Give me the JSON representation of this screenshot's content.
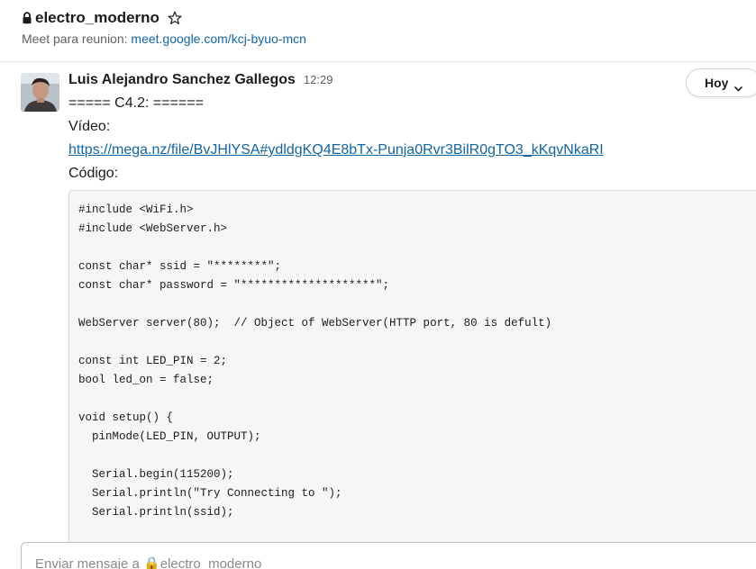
{
  "channel": {
    "name": "electro_moderno",
    "topic_prefix": "Meet para reunion: ",
    "topic_link": "meet.google.com/kcj-byuo-mcn"
  },
  "message": {
    "sender": "Luis Alejandro Sanchez Gallegos",
    "time": "12:29",
    "line1": "===== C4.2: ======",
    "video_label": "Vídeo:",
    "video_link": "https://mega.nz/file/BvJHlYSA#ydldgKQ4E8bTx-Punja0Rvr3BilR0gTO3_kKqvNkaRI",
    "code_label": "Código:",
    "code": "#include <WiFi.h>\n#include <WebServer.h>\n\nconst char* ssid = \"********\";\nconst char* password = \"********************\";\n\nWebServer server(80);  // Object of WebServer(HTTP port, 80 is defult)\n\nconst int LED_PIN = 2;\nbool led_on = false;\n\nvoid setup() {\n  pinMode(LED_PIN, OUTPUT);\n\n  Serial.begin(115200);\n  Serial.println(\"Try Connecting to \");\n  Serial.println(ssid);\n\n"
  },
  "date_divider": {
    "label": "Hoy"
  },
  "composer": {
    "placeholder": "Enviar mensaje a 🔒electro_moderno"
  },
  "icons": {
    "lock": "lock-icon",
    "star": "star-icon",
    "chevron": "chevron-down-icon",
    "avatar": "avatar"
  },
  "colors": {
    "link": "#1264a3",
    "text": "#1d1c1d",
    "muted": "#616061",
    "code_bg": "#f6f6f6"
  }
}
